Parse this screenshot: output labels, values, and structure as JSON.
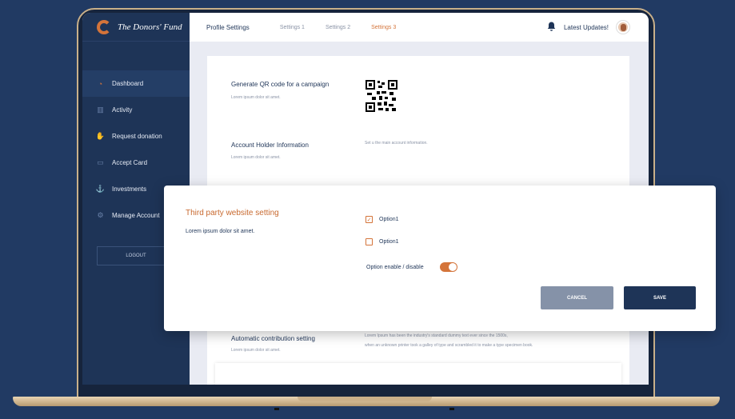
{
  "brand": {
    "logo_text": "The Donors' Fund"
  },
  "sidebar": {
    "items": [
      {
        "label": "Dashboard",
        "icon": "gauge-icon"
      },
      {
        "label": "Activity",
        "icon": "chart-icon"
      },
      {
        "label": "Request donation",
        "icon": "hand-icon"
      },
      {
        "label": "Accept Card",
        "icon": "card-icon"
      },
      {
        "label": "Investments",
        "icon": "investment-icon"
      },
      {
        "label": "Manage Account",
        "icon": "gear-icon"
      }
    ],
    "logout_label": "LOGOUT"
  },
  "topbar": {
    "tabs": [
      "Profile Settings",
      "Settings 1",
      "Settings 2",
      "Settings 3"
    ],
    "updates_label": "Latest Updates!"
  },
  "settings": {
    "qr": {
      "title": "Generate QR code for a campaign",
      "sub": "Lorem ipsum dolor sit amet."
    },
    "account": {
      "title": "Account Holder Information",
      "sub": "Lorem ipsum dolor sit amet.",
      "desc": "Set u the main account information."
    },
    "contribution": {
      "title": "Automatic contribution setting",
      "sub": "Lorem ipsum dolor sit amet.",
      "desc_line1": "Lorem Ipsum has been the industry's standard dummy text ever since the 1500s,",
      "desc_line2": "when an unknown printer took a galley of type and scrambled it to make a type specimen book."
    }
  },
  "modal": {
    "title": "Third party website setting",
    "sub": "Lorem ipsum dolor sit amet.",
    "options": [
      {
        "label": "Option1",
        "checked": true
      },
      {
        "label": "Option1",
        "checked": false
      }
    ],
    "toggle_label": "Option enable / disable",
    "toggle_on": true,
    "cancel_label": "CANCEL",
    "save_label": "SAVE"
  },
  "colors": {
    "navy": "#1e3457",
    "accent": "#d4743a",
    "background": "#213a63"
  }
}
